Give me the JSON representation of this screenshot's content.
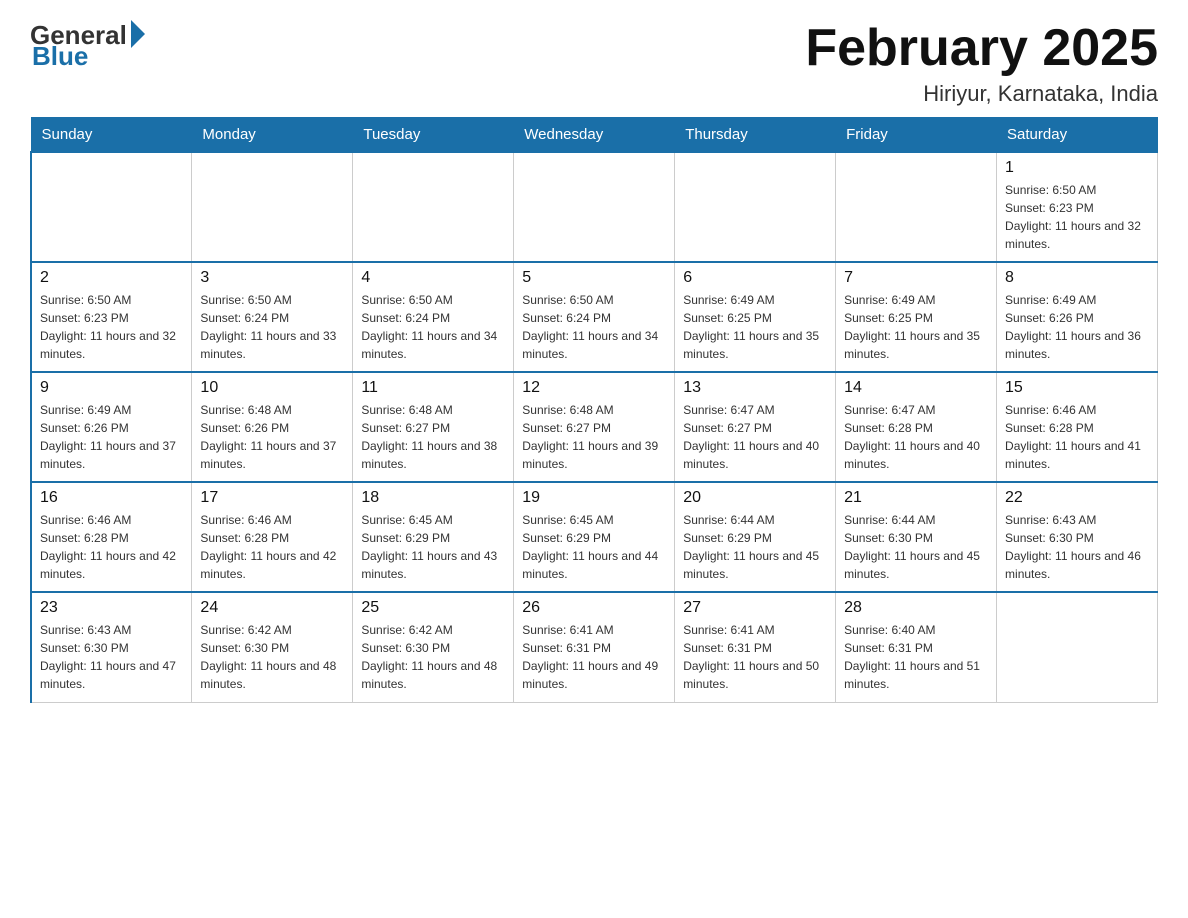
{
  "logo": {
    "general": "General",
    "blue": "Blue"
  },
  "header": {
    "month_year": "February 2025",
    "location": "Hiriyur, Karnataka, India"
  },
  "weekdays": [
    "Sunday",
    "Monday",
    "Tuesday",
    "Wednesday",
    "Thursday",
    "Friday",
    "Saturday"
  ],
  "weeks": [
    [
      {
        "day": "",
        "sunrise": "",
        "sunset": "",
        "daylight": ""
      },
      {
        "day": "",
        "sunrise": "",
        "sunset": "",
        "daylight": ""
      },
      {
        "day": "",
        "sunrise": "",
        "sunset": "",
        "daylight": ""
      },
      {
        "day": "",
        "sunrise": "",
        "sunset": "",
        "daylight": ""
      },
      {
        "day": "",
        "sunrise": "",
        "sunset": "",
        "daylight": ""
      },
      {
        "day": "",
        "sunrise": "",
        "sunset": "",
        "daylight": ""
      },
      {
        "day": "1",
        "sunrise": "Sunrise: 6:50 AM",
        "sunset": "Sunset: 6:23 PM",
        "daylight": "Daylight: 11 hours and 32 minutes."
      }
    ],
    [
      {
        "day": "2",
        "sunrise": "Sunrise: 6:50 AM",
        "sunset": "Sunset: 6:23 PM",
        "daylight": "Daylight: 11 hours and 32 minutes."
      },
      {
        "day": "3",
        "sunrise": "Sunrise: 6:50 AM",
        "sunset": "Sunset: 6:24 PM",
        "daylight": "Daylight: 11 hours and 33 minutes."
      },
      {
        "day": "4",
        "sunrise": "Sunrise: 6:50 AM",
        "sunset": "Sunset: 6:24 PM",
        "daylight": "Daylight: 11 hours and 34 minutes."
      },
      {
        "day": "5",
        "sunrise": "Sunrise: 6:50 AM",
        "sunset": "Sunset: 6:24 PM",
        "daylight": "Daylight: 11 hours and 34 minutes."
      },
      {
        "day": "6",
        "sunrise": "Sunrise: 6:49 AM",
        "sunset": "Sunset: 6:25 PM",
        "daylight": "Daylight: 11 hours and 35 minutes."
      },
      {
        "day": "7",
        "sunrise": "Sunrise: 6:49 AM",
        "sunset": "Sunset: 6:25 PM",
        "daylight": "Daylight: 11 hours and 35 minutes."
      },
      {
        "day": "8",
        "sunrise": "Sunrise: 6:49 AM",
        "sunset": "Sunset: 6:26 PM",
        "daylight": "Daylight: 11 hours and 36 minutes."
      }
    ],
    [
      {
        "day": "9",
        "sunrise": "Sunrise: 6:49 AM",
        "sunset": "Sunset: 6:26 PM",
        "daylight": "Daylight: 11 hours and 37 minutes."
      },
      {
        "day": "10",
        "sunrise": "Sunrise: 6:48 AM",
        "sunset": "Sunset: 6:26 PM",
        "daylight": "Daylight: 11 hours and 37 minutes."
      },
      {
        "day": "11",
        "sunrise": "Sunrise: 6:48 AM",
        "sunset": "Sunset: 6:27 PM",
        "daylight": "Daylight: 11 hours and 38 minutes."
      },
      {
        "day": "12",
        "sunrise": "Sunrise: 6:48 AM",
        "sunset": "Sunset: 6:27 PM",
        "daylight": "Daylight: 11 hours and 39 minutes."
      },
      {
        "day": "13",
        "sunrise": "Sunrise: 6:47 AM",
        "sunset": "Sunset: 6:27 PM",
        "daylight": "Daylight: 11 hours and 40 minutes."
      },
      {
        "day": "14",
        "sunrise": "Sunrise: 6:47 AM",
        "sunset": "Sunset: 6:28 PM",
        "daylight": "Daylight: 11 hours and 40 minutes."
      },
      {
        "day": "15",
        "sunrise": "Sunrise: 6:46 AM",
        "sunset": "Sunset: 6:28 PM",
        "daylight": "Daylight: 11 hours and 41 minutes."
      }
    ],
    [
      {
        "day": "16",
        "sunrise": "Sunrise: 6:46 AM",
        "sunset": "Sunset: 6:28 PM",
        "daylight": "Daylight: 11 hours and 42 minutes."
      },
      {
        "day": "17",
        "sunrise": "Sunrise: 6:46 AM",
        "sunset": "Sunset: 6:28 PM",
        "daylight": "Daylight: 11 hours and 42 minutes."
      },
      {
        "day": "18",
        "sunrise": "Sunrise: 6:45 AM",
        "sunset": "Sunset: 6:29 PM",
        "daylight": "Daylight: 11 hours and 43 minutes."
      },
      {
        "day": "19",
        "sunrise": "Sunrise: 6:45 AM",
        "sunset": "Sunset: 6:29 PM",
        "daylight": "Daylight: 11 hours and 44 minutes."
      },
      {
        "day": "20",
        "sunrise": "Sunrise: 6:44 AM",
        "sunset": "Sunset: 6:29 PM",
        "daylight": "Daylight: 11 hours and 45 minutes."
      },
      {
        "day": "21",
        "sunrise": "Sunrise: 6:44 AM",
        "sunset": "Sunset: 6:30 PM",
        "daylight": "Daylight: 11 hours and 45 minutes."
      },
      {
        "day": "22",
        "sunrise": "Sunrise: 6:43 AM",
        "sunset": "Sunset: 6:30 PM",
        "daylight": "Daylight: 11 hours and 46 minutes."
      }
    ],
    [
      {
        "day": "23",
        "sunrise": "Sunrise: 6:43 AM",
        "sunset": "Sunset: 6:30 PM",
        "daylight": "Daylight: 11 hours and 47 minutes."
      },
      {
        "day": "24",
        "sunrise": "Sunrise: 6:42 AM",
        "sunset": "Sunset: 6:30 PM",
        "daylight": "Daylight: 11 hours and 48 minutes."
      },
      {
        "day": "25",
        "sunrise": "Sunrise: 6:42 AM",
        "sunset": "Sunset: 6:30 PM",
        "daylight": "Daylight: 11 hours and 48 minutes."
      },
      {
        "day": "26",
        "sunrise": "Sunrise: 6:41 AM",
        "sunset": "Sunset: 6:31 PM",
        "daylight": "Daylight: 11 hours and 49 minutes."
      },
      {
        "day": "27",
        "sunrise": "Sunrise: 6:41 AM",
        "sunset": "Sunset: 6:31 PM",
        "daylight": "Daylight: 11 hours and 50 minutes."
      },
      {
        "day": "28",
        "sunrise": "Sunrise: 6:40 AM",
        "sunset": "Sunset: 6:31 PM",
        "daylight": "Daylight: 11 hours and 51 minutes."
      },
      {
        "day": "",
        "sunrise": "",
        "sunset": "",
        "daylight": ""
      }
    ]
  ]
}
